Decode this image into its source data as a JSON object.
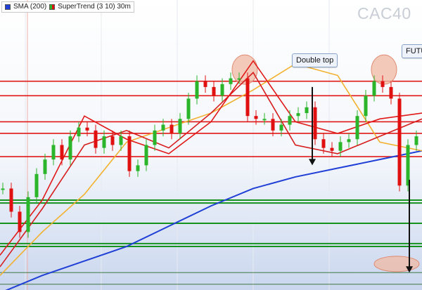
{
  "header": {
    "legend": [
      {
        "label": "SMA (200)",
        "icon": "blue-square",
        "color": "#1f3fd6"
      },
      {
        "label": "SuperTrend (3 10) 30m",
        "icon": "green-red-square",
        "color": "#2bb52b"
      }
    ],
    "watermark": "CAC40"
  },
  "annotations": {
    "double_top": "Double top",
    "future": "FUTU"
  },
  "colors": {
    "resistance": "#e01818",
    "support": "#16921e",
    "sma200": "#1f3fd6",
    "sma_short": "#f2b12e",
    "ema": "#d61e1e",
    "candle_up": "#2bb52b",
    "candle_down": "#e01010",
    "highlight_fill": "#f0b9a3"
  },
  "chart_data": {
    "type": "line",
    "title": "",
    "xlabel": "",
    "ylabel": "",
    "xlim": [
      0,
      100
    ],
    "ylim": [
      0,
      100
    ],
    "grid": true,
    "legend_position": "top-left",
    "series": [
      {
        "name": "SMA (200)",
        "x": [
          0,
          10,
          20,
          30,
          40,
          50,
          60,
          70,
          80,
          90,
          100
        ],
        "values": [
          -1,
          5,
          10,
          15,
          22,
          29,
          35,
          39,
          42,
          45,
          48
        ]
      },
      {
        "name": "",
        "x": [
          0,
          10,
          20,
          30,
          40,
          50,
          60,
          70,
          80,
          90,
          100
        ],
        "values": [
          5,
          20,
          33,
          51,
          56,
          61,
          69,
          78,
          74,
          51,
          48
        ]
      },
      {
        "name": "",
        "x": [
          0,
          10,
          20,
          30,
          40,
          50,
          60,
          70,
          80,
          90,
          100
        ],
        "values": [
          8,
          28,
          50,
          55,
          49,
          61,
          75,
          50,
          47,
          53,
          59
        ]
      },
      {
        "name": "",
        "x": [
          0,
          10,
          20,
          30,
          40,
          50,
          60,
          70,
          80,
          90,
          100
        ],
        "values": [
          12,
          31,
          60,
          52,
          47,
          58,
          79,
          58,
          54,
          59,
          61
        ]
      }
    ],
    "horizontal_levels": {
      "resistance": [
        72,
        67,
        58,
        54,
        46
      ],
      "support": [
        31,
        30,
        23,
        16,
        15
      ],
      "neutral": [
        6,
        2
      ]
    },
    "price": {
      "x": [
        0,
        2,
        4,
        6,
        8,
        10,
        12,
        14,
        16,
        18,
        20,
        22,
        24,
        26,
        28,
        30,
        32,
        34,
        36,
        38,
        40,
        42,
        44,
        46,
        48,
        50,
        52,
        54,
        56,
        58,
        60,
        62,
        64,
        66,
        68,
        70,
        72,
        74,
        76,
        78,
        80,
        82,
        84,
        86,
        88,
        90,
        92,
        94,
        96,
        98
      ],
      "values": [
        35,
        27,
        20,
        32,
        40,
        45,
        50,
        45,
        53,
        56,
        55,
        49,
        53,
        50,
        53,
        41,
        43,
        50,
        55,
        57,
        54,
        59,
        66,
        72,
        70,
        67,
        71,
        73,
        73,
        60,
        59,
        59,
        55,
        57,
        60,
        61,
        63,
        52,
        49,
        48,
        51,
        52,
        60,
        67,
        72,
        70,
        66,
        36,
        50,
        53
      ]
    },
    "arrows": [
      {
        "x": 74,
        "from": 70,
        "to": 43
      },
      {
        "x": 97,
        "from": 38,
        "to": 6
      }
    ],
    "highlight_circles": [
      {
        "x": 58,
        "y": 76
      },
      {
        "x": 91,
        "y": 76
      },
      {
        "x": 94,
        "y": 9
      }
    ]
  }
}
